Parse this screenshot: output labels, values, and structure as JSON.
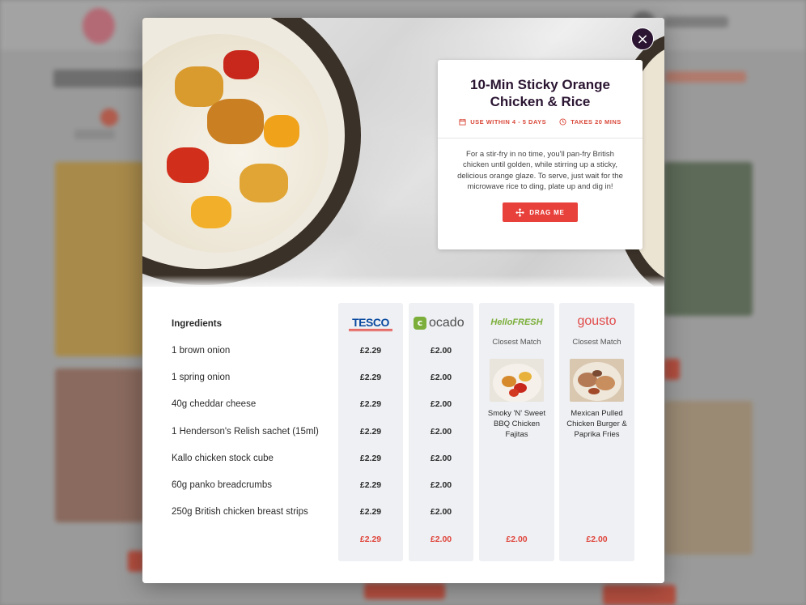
{
  "recipe": {
    "title": "10-Min Sticky Orange Chicken & Rice",
    "use_within": "USE WITHIN 4 - 5 DAYS",
    "takes": "TAKES 20 MINS",
    "description": "For a stir-fry in no time, you'll pan-fry British chicken until golden, while stirring up a sticky, delicious orange glaze. To serve, just wait for the microwave rice to ding, plate up and dig in!",
    "drag_label": "DRAG ME"
  },
  "close_label": "×",
  "ingredients_header": "Ingredients",
  "ingredients": [
    "1 brown onion",
    "1 spring onion",
    "40g cheddar cheese",
    "1 Henderson's Relish sachet (15ml)",
    "Kallo chicken stock cube",
    "60g panko breadcrumbs",
    "250g British chicken breast strips"
  ],
  "retailers": {
    "tesco": {
      "logo_text": "TESCO",
      "prices": [
        "£2.29",
        "£2.29",
        "£2.29",
        "£2.29",
        "£2.29",
        "£2.29",
        "£2.29"
      ],
      "total": "£2.29"
    },
    "ocado": {
      "logo_text": "ocado",
      "prices": [
        "£2.00",
        "£2.00",
        "£2.00",
        "£2.00",
        "£2.00",
        "£2.00",
        "£2.00"
      ],
      "total": "£2.00"
    },
    "hellofresh": {
      "logo_text": "HelloFRESH",
      "closest_label": "Closest Match",
      "match_name": "Smoky 'N' Sweet BBQ Chicken Fajitas",
      "total": "£2.00"
    },
    "gousto": {
      "logo_text": "gousto",
      "closest_label": "Closest Match",
      "match_name": "Mexican Pulled Chicken Burger & Paprika Fries",
      "total": "£2.00"
    }
  },
  "colors": {
    "accent": "#e8413b",
    "title": "#2b1532",
    "tesco_blue": "#0a4aa0",
    "ocado_green": "#7bae3a",
    "gousto_red": "#e24a4a"
  },
  "icons": [
    "calendar-icon",
    "clock-icon",
    "move-icon",
    "close-icon"
  ]
}
